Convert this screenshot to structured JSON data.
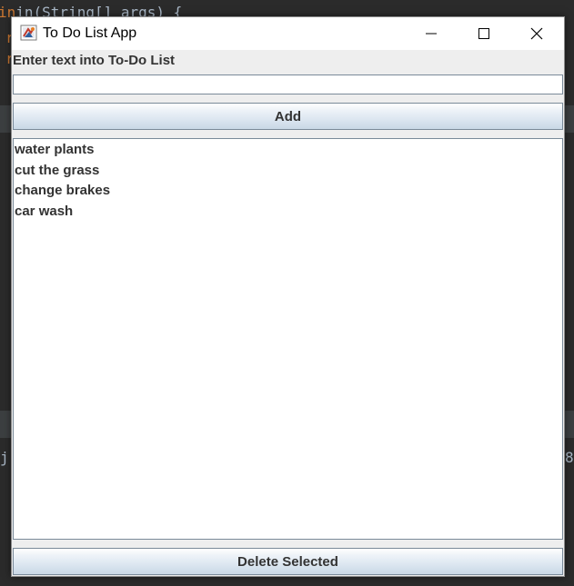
{
  "background": {
    "code_top": "in(String[] args) {",
    "code_line2": "r",
    "code_line3": "r",
    "side_left": "j",
    "side_right": "8"
  },
  "window": {
    "title": "To Do List App",
    "controls": {
      "minimize_icon": "minimize-icon",
      "maximize_icon": "maximize-icon",
      "close_icon": "close-icon"
    }
  },
  "form": {
    "prompt_label": "Enter text into To-Do List",
    "input_value": "",
    "add_button_label": "Add"
  },
  "todo_list": {
    "items": [
      "water plants",
      "cut the grass",
      "change brakes",
      "car wash"
    ]
  },
  "delete_button_label": "Delete Selected",
  "colors": {
    "text": "#333333",
    "button_border": "#7a8a99",
    "panel_bg": "#eeeeee",
    "ide_bg": "#2b2b2b"
  }
}
